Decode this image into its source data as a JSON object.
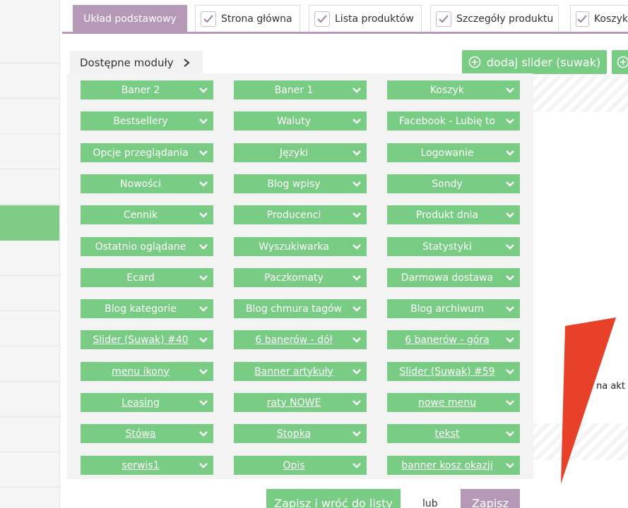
{
  "tabs": [
    {
      "label": "Układ podstawowy",
      "active": true
    },
    {
      "label": "Strona główna",
      "active": false
    },
    {
      "label": "Lista produktów",
      "active": false
    },
    {
      "label": "Szczegóły produktu",
      "active": false
    },
    {
      "label": "Koszyk",
      "active": false
    }
  ],
  "modules_panel": {
    "title": "Dostępne moduły",
    "modules": [
      {
        "label": "Baner 2",
        "link": false
      },
      {
        "label": "Baner 1",
        "link": false
      },
      {
        "label": "Koszyk",
        "link": false
      },
      {
        "label": "Bestsellery",
        "link": false
      },
      {
        "label": "Waluty",
        "link": false
      },
      {
        "label": "Facebook - Lubię to",
        "link": false
      },
      {
        "label": "Opcje przeglądania",
        "link": false
      },
      {
        "label": "Języki",
        "link": false
      },
      {
        "label": "Logowanie",
        "link": false
      },
      {
        "label": "Nowości",
        "link": false
      },
      {
        "label": "Blog wpisy",
        "link": false
      },
      {
        "label": "Sondy",
        "link": false
      },
      {
        "label": "Cennik",
        "link": false
      },
      {
        "label": "Producenci",
        "link": false
      },
      {
        "label": "Produkt dnia",
        "link": false
      },
      {
        "label": "Ostatnio oglądane",
        "link": false
      },
      {
        "label": "Wyszukiwarka",
        "link": false
      },
      {
        "label": "Statystyki",
        "link": false
      },
      {
        "label": "Ecard",
        "link": false
      },
      {
        "label": "Paczkomaty",
        "link": false
      },
      {
        "label": "Darmowa dostawa",
        "link": false
      },
      {
        "label": "Blog kategorie",
        "link": false
      },
      {
        "label": "Blog chmura tagów",
        "link": false
      },
      {
        "label": "Blog archiwum",
        "link": false
      },
      {
        "label": "Slider (Suwak) #40",
        "link": true
      },
      {
        "label": "6 banerów - dół",
        "link": true
      },
      {
        "label": "6 banerów - góra",
        "link": true
      },
      {
        "label": "menu ikony",
        "link": true
      },
      {
        "label": "Banner artykuły",
        "link": true
      },
      {
        "label": "Slider (Suwak) #59",
        "link": true
      },
      {
        "label": "Leasing",
        "link": true
      },
      {
        "label": "raty NOWE",
        "link": true
      },
      {
        "label": "nowe menu",
        "link": true
      },
      {
        "label": "Stówa",
        "link": true
      },
      {
        "label": "Stopka",
        "link": true
      },
      {
        "label": "tekst",
        "link": true
      },
      {
        "label": "serwis1",
        "link": true
      },
      {
        "label": "Opis",
        "link": true
      },
      {
        "label": "banner kosz okazji",
        "link": true
      }
    ]
  },
  "add_slider_label": "dodaj slider (suwak)",
  "truncated_text": "na akt",
  "footer": {
    "save_return_label": "Zapisz i wróć do listy",
    "or_label": "lub",
    "save_label": "Zapisz"
  },
  "colors": {
    "green": "#78cc83",
    "purple": "#b698b7",
    "arrow_red": "#e8412a"
  },
  "icons": {
    "tab_check": "check-icon",
    "module_caret": "chevron-down-icon",
    "panel_arrow": "chevron-right-icon",
    "add_slider": "plus-circle-icon"
  }
}
